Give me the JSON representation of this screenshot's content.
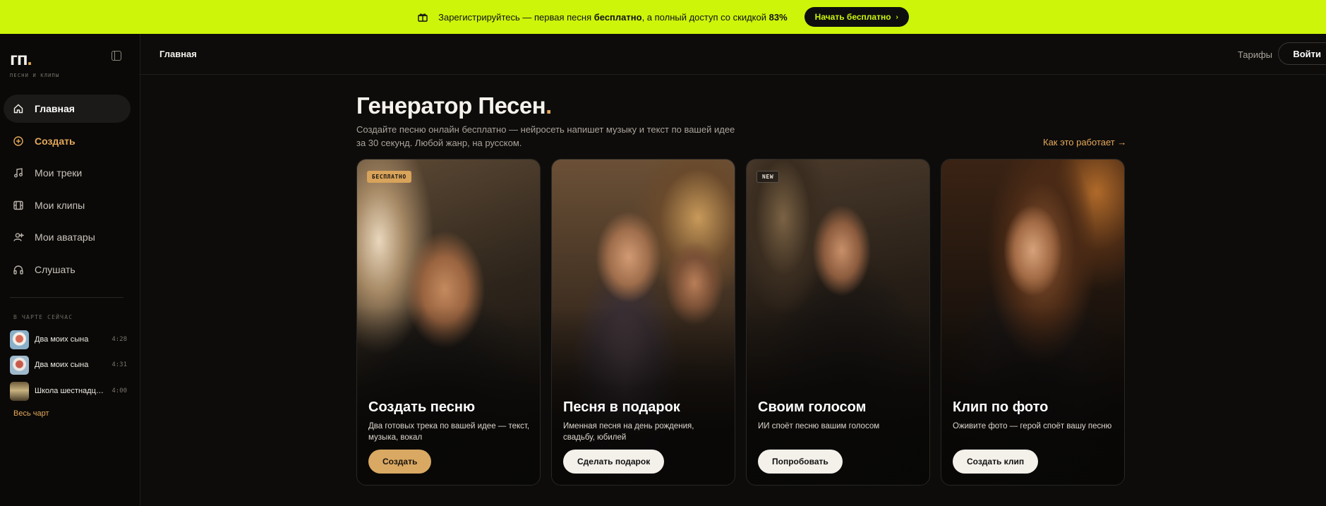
{
  "promo": {
    "prefix": "Зарегистрируйтесь — первая песня ",
    "free": "бесплатно",
    "middle": ", а полный доступ со скидкой ",
    "discount": "83%",
    "cta_label": "Начать бесплатно",
    "bg_color": "#ccf50a"
  },
  "sidebar": {
    "logo": "гп",
    "logo_dot": ".",
    "tagline": "ПЕСНИ И КЛИПЫ",
    "nav": [
      {
        "label": "Главная",
        "icon": "home-icon",
        "active": true
      },
      {
        "label": "Создать",
        "icon": "plus-circle-icon"
      },
      {
        "label": "Мои треки",
        "icon": "music-note-icon"
      },
      {
        "label": "Мои клипы",
        "icon": "film-icon"
      },
      {
        "label": "Мои аватары",
        "icon": "user-icon"
      },
      {
        "label": "Слушать",
        "icon": "headphones-icon"
      }
    ],
    "chart_heading": "В ЧАРТЕ СЕЙЧАС",
    "tracks": [
      {
        "title": "Два моих сына",
        "duration": "4:28"
      },
      {
        "title": "Два моих сына",
        "duration": "4:31"
      },
      {
        "title": "Школа шестнадцать",
        "duration": "4:00"
      }
    ],
    "all_chart": "Весь чарт"
  },
  "header": {
    "breadcrumb": "Главная",
    "tariffs": "Тарифы",
    "login": "Войти"
  },
  "main": {
    "title": "Генератор Песен",
    "title_dot": ".",
    "subtitle": "Создайте песню онлайн бесплатно — нейросеть напишет музыку и текст по вашей идее за 30 секунд. Любой жанр, на русском.",
    "how_link": "Как это работает →",
    "accent_color": "#e5a85a",
    "cards": [
      {
        "badge": "БЕСПЛАТНО",
        "title": "Создать песню",
        "desc": "Два готовых трека по вашей идее — текст, музыка, вокал",
        "button": "Создать"
      },
      {
        "badge": "",
        "title": "Песня в подарок",
        "desc": "Именная песня на день рождения, свадьбу, юбилей",
        "button": "Сделать подарок"
      },
      {
        "badge": "NEW",
        "title": "Своим голосом",
        "desc": "ИИ споёт песню вашим голосом",
        "button": "Попробовать"
      },
      {
        "badge": "",
        "title": "Клип по фото",
        "desc": "Оживите фото — герой споёт вашу песню",
        "button": "Создать клип"
      }
    ]
  }
}
